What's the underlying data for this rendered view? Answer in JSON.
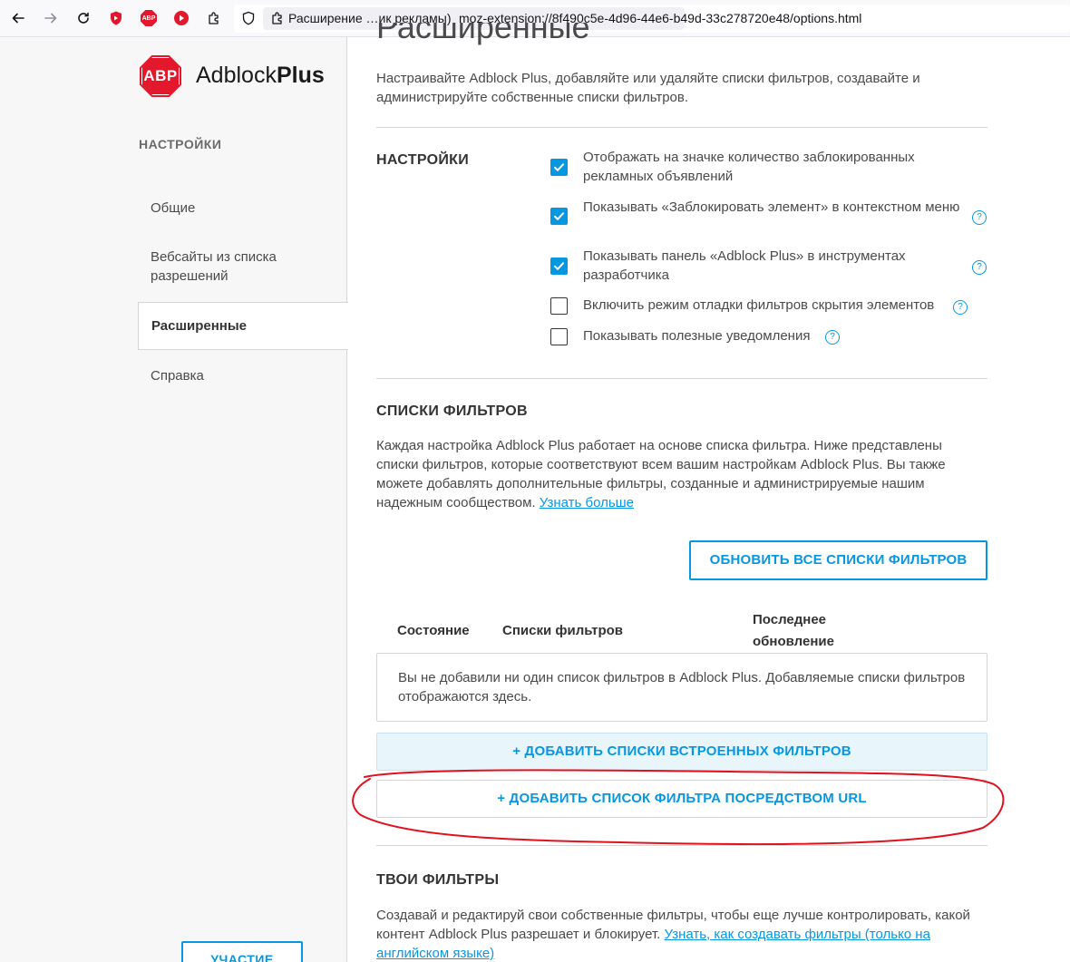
{
  "browser": {
    "tab_title": "Расширение …ик рекламы)",
    "url": "moz-extension://8f490c5e-4d96-44e6-b49d-33c278720e48/options.html",
    "abp_badge": "ABP"
  },
  "sidebar": {
    "brand_badge": "ABP",
    "brand_name_a": "Adblock",
    "brand_name_b": "Plus",
    "heading": "НАСТРОЙКИ",
    "items": [
      {
        "label": "Общие"
      },
      {
        "label": "Вебсайты из списка разрешений"
      },
      {
        "label": "Расширенные"
      },
      {
        "label": "Справка"
      }
    ],
    "bottom_button": "УЧАСТИЕ"
  },
  "main": {
    "title": "Расширенные",
    "intro": "Настраивайте Adblock Plus, добавляйте или удаляйте списки фильтров, создавайте и администрируйте собственные списки фильтров.",
    "settings": {
      "heading": "НАСТРОЙКИ",
      "options": [
        {
          "label": "Отображать на значке количество заблокированных рекламных объявлений",
          "checked": true
        },
        {
          "label": "Показывать «Заблокировать элемент» в контекстном меню",
          "checked": true
        },
        {
          "label": "Показывать панель «Adblock Plus» в инструментах разработчика",
          "checked": true
        },
        {
          "label": "Включить режим отладки фильтров скрытия элементов",
          "checked": false
        },
        {
          "label": "Показывать полезные уведомления",
          "checked": false
        }
      ],
      "help_glyph": "?"
    },
    "filter_lists": {
      "heading": "СПИСКИ ФИЛЬТРОВ",
      "description": "Каждая настройка Adblock Plus работает на основе списка фильтра. Ниже представлены списки фильтров, которые соответствуют всем вашим настройкам Adblock Plus. Вы также можете добавлять дополнительные фильтры, созданные и администрируемые нашим надежным сообществом.",
      "learn_more": "Узнать больше",
      "update_all_button": "ОБНОВИТЬ ВСЕ СПИСКИ ФИЛЬТРОВ",
      "columns": {
        "status": "Состояние",
        "lists": "Списки фильтров",
        "last_update_1": "Последнее",
        "last_update_2": "обновление"
      },
      "empty_message": "Вы не добавили ни один список фильтров в Adblock Plus. Добавляемые списки фильтров отображаются здесь.",
      "add_builtin_button": "+ ДОБАВИТЬ СПИСКИ ВСТРОЕННЫХ ФИЛЬТРОВ",
      "add_url_button": "+ ДОБАВИТЬ СПИСОК ФИЛЬТРА ПОСРЕДСТВОМ URL"
    },
    "your_filters": {
      "heading": "ТВОИ ФИЛЬТРЫ",
      "description": "Создавай и редактируй свои собственные фильтры, чтобы еще лучше контролировать, какой контент Adblock Plus разрешает и блокирует.",
      "link": "Узнать, как создавать фильтры (только на английском языке)"
    }
  },
  "colors": {
    "accent": "#0797e1",
    "brand_red": "#e3182d",
    "annotation": "#e0121f"
  }
}
